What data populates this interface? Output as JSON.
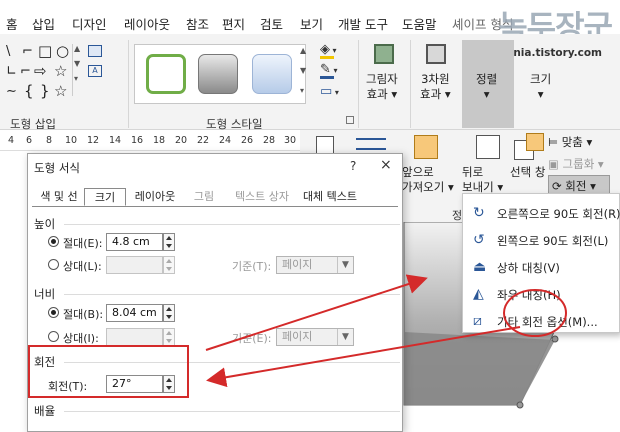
{
  "tabs": [
    "홈",
    "삽입",
    "디자인",
    "레이아웃",
    "참조",
    "편지",
    "검토",
    "보기",
    "개발 도구",
    "도움말",
    "셰이프 형식"
  ],
  "watermark": {
    "text": "녹두장군",
    "url": "mainia.tistory.com"
  },
  "ribbon": {
    "insert_shapes_label": "도형 삽입",
    "shape_styles_label": "도형 스타일",
    "shadow_effect_label": [
      "그림자",
      "효과"
    ],
    "threed_effect_label": [
      "3차원",
      "효과"
    ],
    "arrange_label": "정렬",
    "size_label": "크기",
    "shape_glyphs": [
      "\\",
      "⌐",
      "□",
      "○",
      "∟",
      "⌐",
      "⇨",
      "☆",
      "∼",
      "{",
      "}",
      "☆"
    ]
  },
  "ruler": [
    "4",
    "6",
    "8",
    "10",
    "12",
    "14",
    "16",
    "18",
    "20",
    "22",
    "24",
    "26",
    "28",
    "30",
    "32",
    "34"
  ],
  "arrange": {
    "align_label": "맞춤",
    "group_label": "그룹화",
    "rotate_label": "회전",
    "bring_forward": [
      "앞으로",
      "가져오기"
    ],
    "send_backward": [
      "뒤로",
      "보내기"
    ],
    "selection_pane": "선택 창",
    "group_abbrev": "정"
  },
  "rotate_menu": {
    "items": [
      {
        "icon": "rotate-right-icon",
        "label": "오른쪽으로 90도 회전(R)"
      },
      {
        "icon": "rotate-left-icon",
        "label": "왼쪽으로 90도 회전(L)"
      },
      {
        "icon": "flip-vertical-icon",
        "label": "상하 대칭(V)"
      },
      {
        "icon": "flip-horizontal-icon",
        "label": "좌우 대칭(H)"
      },
      {
        "icon": "more-rotation-icon",
        "label": "기타 회전 옵션(M)..."
      }
    ]
  },
  "dialog": {
    "title": "도형 서식",
    "help": "?",
    "close": "×",
    "tabs": [
      "색 및 선",
      "크기",
      "레이아웃",
      "그림",
      "텍스트 상자",
      "대체 텍스트"
    ],
    "height": {
      "heading": "높이",
      "absolute_label": "절대(E):",
      "absolute_value": "4.8 cm",
      "relative_label": "상대(L):",
      "base_label": "기준(T):",
      "base_value": "페이지"
    },
    "width": {
      "heading": "너비",
      "absolute_label": "절대(B):",
      "absolute_value": "8.04 cm",
      "relative_label": "상대(I):",
      "base_label": "기준(E):",
      "base_value": "페이지"
    },
    "rotation": {
      "heading": "회전",
      "label": "회전(T):",
      "value": "27°"
    },
    "scale_heading": "배율"
  },
  "colors": {
    "annotation_red": "#d42a2a",
    "ribbon_bg": "#f3f3f3",
    "accent_blue": "#2b5797",
    "shape_gray": "#8a8a8a"
  }
}
